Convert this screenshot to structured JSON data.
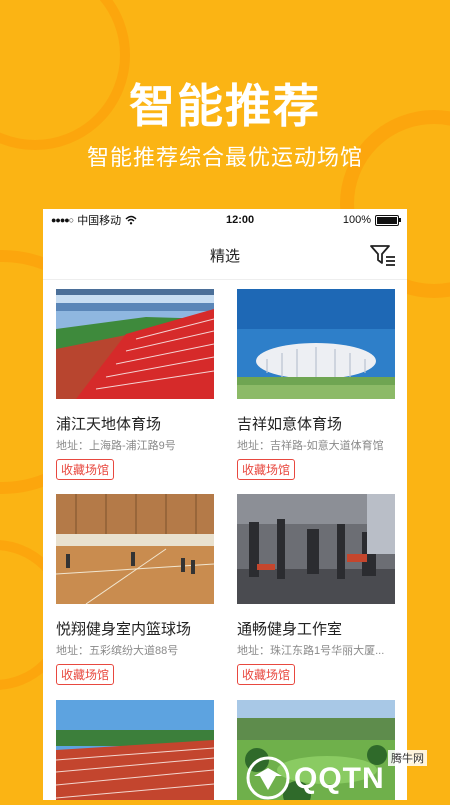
{
  "banner": {
    "headline": "智能推荐",
    "subline": "智能推荐综合最优运动场馆"
  },
  "status_bar": {
    "signal": "●●●●○",
    "carrier": "中国移动",
    "time": "12:00",
    "battery": "100%"
  },
  "nav": {
    "title": "精选",
    "filter_icon": "filter-icon"
  },
  "venues": [
    {
      "name": "浦江天地体育场",
      "address": "地址：上海路-浦江路9号",
      "action": "收藏场馆",
      "image": "stadium-seats"
    },
    {
      "name": "吉祥如意体育场",
      "address": "地址：吉祥路-如意大道体育馆",
      "action": "收藏场馆",
      "image": "stadium-exterior"
    },
    {
      "name": "悦翔健身室内篮球场",
      "address": "地址：五彩缤纷大道88号",
      "action": "收藏场馆",
      "image": "indoor-court"
    },
    {
      "name": "通畅健身工作室",
      "address": "地址：珠江东路1号华丽大厦...",
      "action": "收藏场馆",
      "image": "gym-equipment"
    },
    {
      "name": "",
      "address": "",
      "action": "",
      "image": "running-track"
    },
    {
      "name": "",
      "address": "",
      "action": "",
      "image": "golf-course"
    }
  ],
  "watermark": {
    "site": "腾牛网",
    "logo": "QQTN"
  },
  "colors": {
    "background": "#FBB414",
    "accent": "#E8483F"
  }
}
